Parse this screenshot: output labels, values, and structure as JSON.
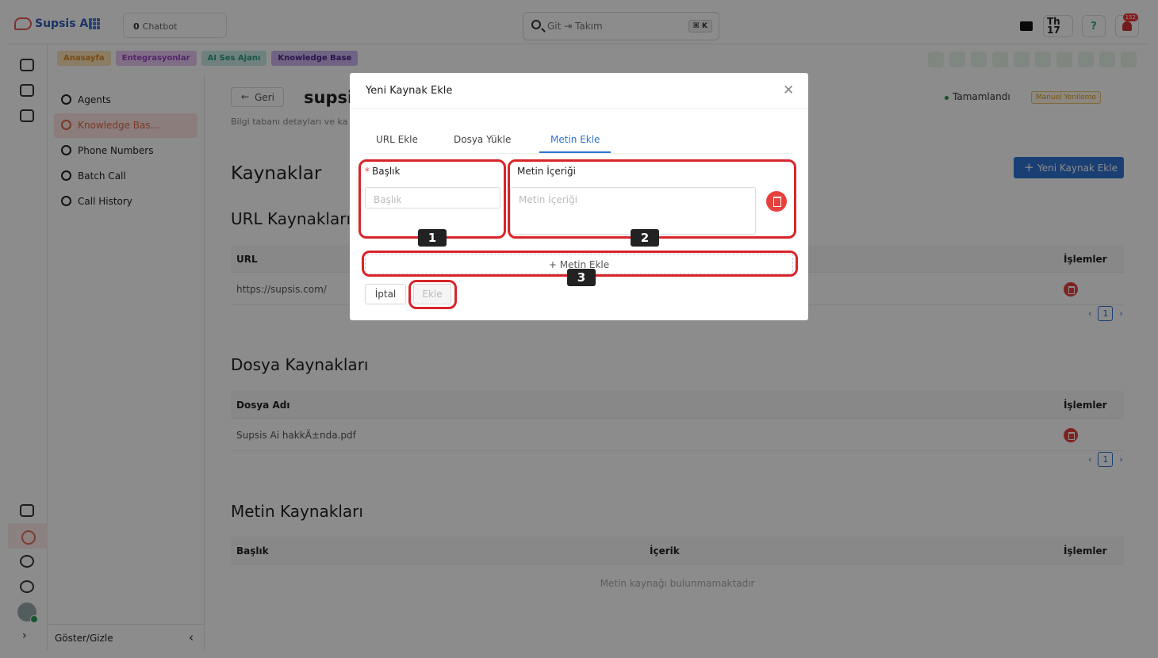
{
  "app": {
    "name": "Supsis Ai",
    "chatbot_count": "0",
    "chatbot_label": "Chatbot"
  },
  "search": {
    "value": "Git ⇥ Takım",
    "shortcut": "⌘ K"
  },
  "topright": {
    "th_line1": "Th",
    "th_line2": "17",
    "help": "?",
    "notifications": "152"
  },
  "crumbs": [
    {
      "label": "Anasayfa",
      "color": "#fbe3b5",
      "text": "#d9882a"
    },
    {
      "label": "Entegrasyonlar",
      "color": "#e8c9f3",
      "text": "#9a44c1"
    },
    {
      "label": "AI Ses Ajanı",
      "color": "#c9ece6",
      "text": "#2a9a86"
    },
    {
      "label": "Knowledge Base",
      "color": "#cdb4ee",
      "text": "#4a2a88"
    }
  ],
  "sidebar": {
    "items": [
      {
        "label": "Agents",
        "icon": "headset-icon",
        "active": false
      },
      {
        "label": "Knowledge Bas...",
        "icon": "bulb-icon",
        "active": true
      },
      {
        "label": "Phone Numbers",
        "icon": "phone-icon",
        "active": false
      },
      {
        "label": "Batch Call",
        "icon": "phone-icon",
        "active": false
      },
      {
        "label": "Call History",
        "icon": "history-icon",
        "active": false
      }
    ],
    "toggle": "Göster/Gizle"
  },
  "page": {
    "back": "Geri",
    "title": "supsis",
    "description": "Bilgi tabanı detayları ve ka",
    "status": "Tamamlandı",
    "manual_refresh": "Manuel Yenileme",
    "new_source": "Yeni Kaynak Ekle",
    "sources_title": "Kaynaklar",
    "url_section": {
      "title": "URL Kaynakları",
      "col_url": "URL",
      "col_actions": "İşlemler",
      "rows": [
        {
          "url": "https://supsis.com/"
        }
      ],
      "page": "1"
    },
    "file_section": {
      "title": "Dosya Kaynakları",
      "col_name": "Dosya Adı",
      "col_actions": "İşlemler",
      "rows": [
        {
          "name": "Supsis Ai hakkÄ±nda.pdf"
        }
      ],
      "page": "1"
    },
    "text_section": {
      "title": "Metin Kaynakları",
      "col_title": "Başlık",
      "col_content": "İçerik",
      "col_actions": "İşlemler",
      "empty": "Metin kaynağı bulunmamaktadır"
    }
  },
  "modal": {
    "title": "Yeni Kaynak Ekle",
    "close": "✕",
    "tabs": [
      "URL Ekle",
      "Dosya Yükle",
      "Metin Ekle"
    ],
    "active_tab": "Metin Ekle",
    "title_label": "Başlık",
    "title_placeholder": "Başlık",
    "content_label": "Metin İçeriği",
    "content_placeholder": "Metin İçeriği",
    "add_text": "Metin Ekle",
    "cancel": "İptal",
    "submit": "Ekle"
  },
  "annotations": [
    "1",
    "2",
    "3"
  ]
}
